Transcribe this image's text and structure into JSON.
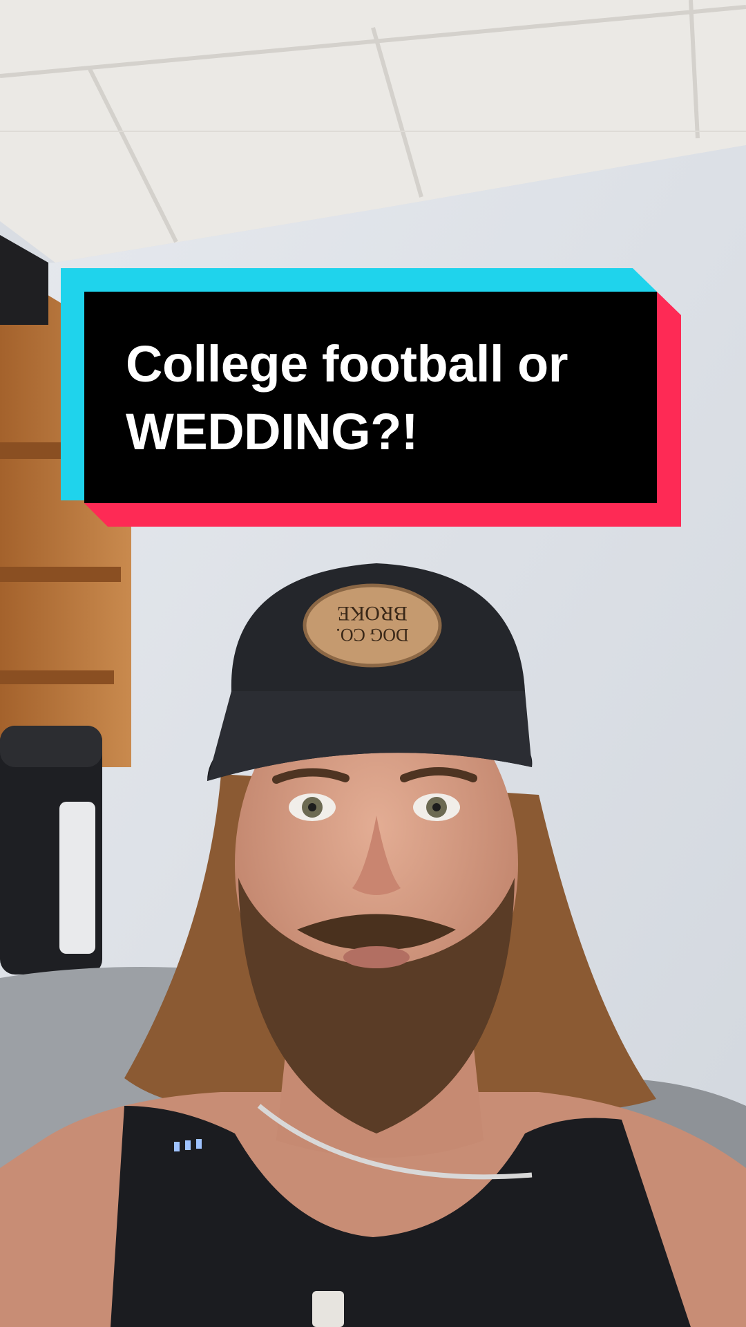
{
  "caption": {
    "line1": "College football or",
    "line2": "WEDDING?!"
  },
  "cap_patch": {
    "line1": "BROKE",
    "line2": "DOG CO."
  },
  "colors": {
    "caption_box": "#000000",
    "caption_accent_cyan": "#1fd3ec",
    "caption_accent_red": "#fe2a55",
    "caption_text": "#ffffff",
    "wall": "#dfe3e8",
    "ceiling": "#eceae6",
    "shelf_wood": "#b9763e",
    "cap": "#24262b",
    "patch": "#c59a6f",
    "beard": "#5a3c26",
    "hair": "#8b5a33",
    "skin": "#d39a82",
    "tank_top": "#1b1c20",
    "couch": "#9a9ea3"
  }
}
